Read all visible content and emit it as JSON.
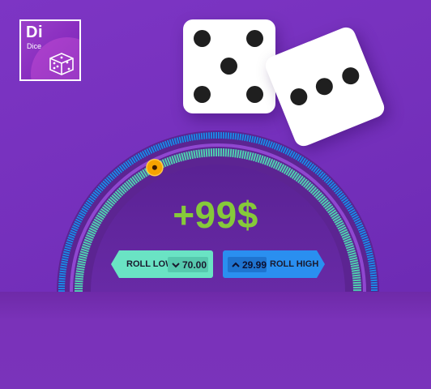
{
  "logo": {
    "symbol": "Di",
    "name": "Dice",
    "icon": "dice-cube-icon"
  },
  "dice": [
    {
      "name": "die-left",
      "face": 5
    },
    {
      "name": "die-right",
      "face": 3
    }
  ],
  "gauge": {
    "progress": 0.35,
    "marker_icon": "slider-knob-icon"
  },
  "win_amount": "+99$",
  "roll_low": {
    "label": "ROLL LOW",
    "value": "70.00",
    "icon": "chevron-down-icon"
  },
  "roll_high": {
    "label": "ROLL HIGH",
    "value": "29.99",
    "icon": "chevron-up-icon"
  },
  "colors": {
    "background": "#7530bc",
    "win_text": "#86c93a",
    "roll_low": "#6ae3c4",
    "roll_high": "#2a8ff0",
    "gauge_blue": "#1e88e5",
    "gauge_teal": "#4fd1b0",
    "marker": "#f5a300"
  }
}
